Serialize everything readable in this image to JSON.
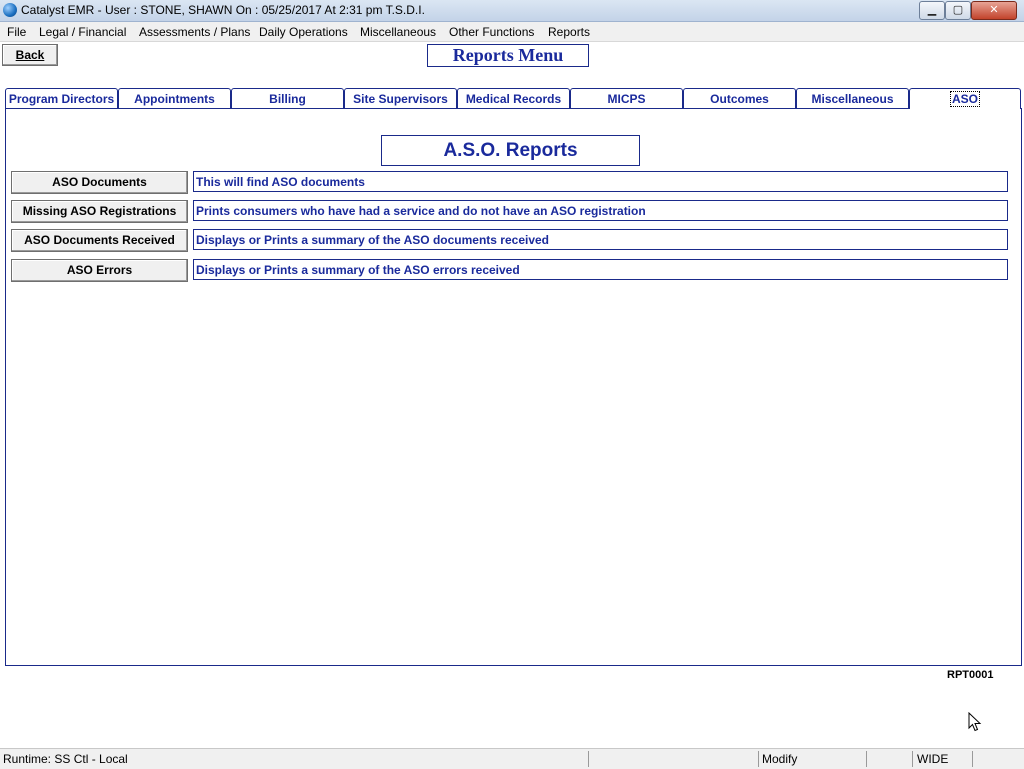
{
  "window": {
    "title": "Catalyst EMR  - User : STONE, SHAWN On : 05/25/2017 At  2:31 pm  T.S.D.I.",
    "min_label": "▁",
    "max_label": "▢",
    "close_label": "✕"
  },
  "menu": {
    "items": [
      "File",
      "Legal / Financial",
      "Assessments / Plans",
      "Daily Operations",
      "Miscellaneous",
      "Other Functions",
      "Reports"
    ]
  },
  "header": {
    "back_label": "Back",
    "title": "Reports Menu"
  },
  "tabs": [
    "Program Directors",
    "Appointments",
    "Billing",
    "Site Supervisors",
    "Medical Records",
    "MICPS",
    "Outcomes",
    "Miscellaneous",
    "ASO"
  ],
  "active_tab": "ASO",
  "section": {
    "title": "A.S.O. Reports"
  },
  "reports": [
    {
      "button": "ASO Documents",
      "description": "This will find ASO documents"
    },
    {
      "button": "Missing ASO Registrations",
      "description": "Prints consumers who have had a service and do not have an ASO registration"
    },
    {
      "button": "ASO Documents Received",
      "description": "Displays or Prints a summary of the ASO documents received"
    },
    {
      "button": "ASO Errors",
      "description": "Displays or Prints a summary of the ASO errors received"
    }
  ],
  "form_code": "RPT0001",
  "status": {
    "runtime": "Runtime: SS Ctl - Local",
    "mode": "Modify",
    "width_mode": "WIDE"
  },
  "colors": {
    "accent": "#1a2a9c",
    "border": "#1a2a8a"
  }
}
